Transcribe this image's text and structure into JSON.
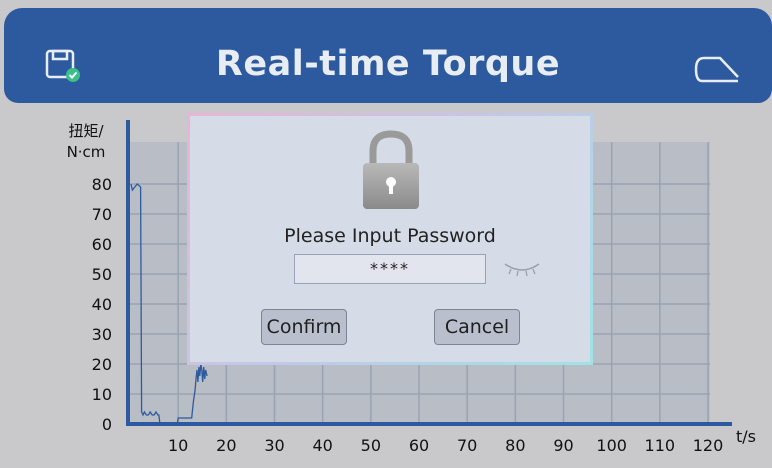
{
  "header": {
    "title": "Real-time Torque",
    "save_icon": "save-icon",
    "back_icon": "back-icon",
    "bg_color": "#2d5a9e"
  },
  "chart_data": {
    "type": "line",
    "ylabel": "扭矩/\nN·cm",
    "ylabel_line1": "扭矩/",
    "ylabel_line2": "N·cm",
    "xlabel": "t/s",
    "ylim": [
      0,
      80
    ],
    "xlim": [
      0,
      120
    ],
    "yticks": [
      0,
      10,
      20,
      30,
      40,
      50,
      60,
      70,
      80
    ],
    "xticks": [
      10,
      20,
      30,
      40,
      50,
      60,
      70,
      80,
      90,
      100,
      110,
      120
    ],
    "grid": true,
    "series": [
      {
        "color": "#2d5a9e",
        "x": [
          0.2,
          0.5,
          1.0,
          1.5,
          2.2,
          2.4,
          2.7,
          3.0,
          3.4,
          3.8,
          4.2,
          4.6,
          5.0,
          5.4,
          5.8,
          6.0,
          6.2,
          7.0,
          9.8,
          10.0,
          12.8,
          13.0,
          13.2,
          13.5,
          13.7,
          13.9,
          14.1,
          14.3,
          14.5,
          14.7,
          14.9,
          15.1,
          15.3,
          15.5,
          15.7,
          16.0
        ],
        "y": [
          80,
          78,
          79,
          80,
          79,
          4,
          3,
          4,
          3,
          3,
          4,
          3,
          3,
          4,
          3,
          3,
          0,
          0,
          0,
          2,
          2,
          5,
          8,
          11,
          15,
          18,
          14,
          19,
          16,
          20,
          18,
          14,
          19,
          15,
          18,
          16
        ]
      }
    ]
  },
  "dialog": {
    "lock_icon": "lock-icon",
    "title": "Please Input Password",
    "password_value": "****",
    "eye_icon": "eye-closed-icon",
    "confirm_label": "Confirm",
    "cancel_label": "Cancel"
  }
}
